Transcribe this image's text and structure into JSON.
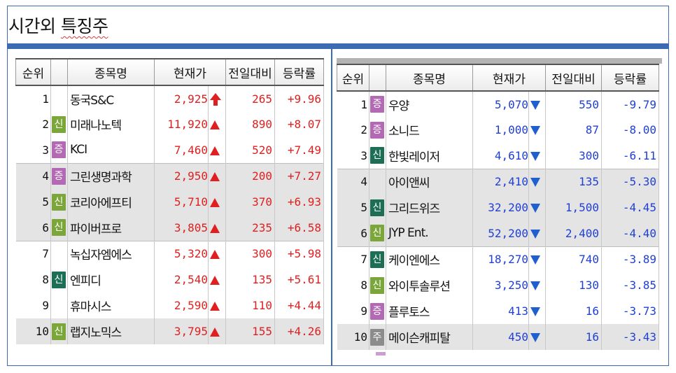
{
  "title": {
    "plain": "시간외 ",
    "underlined": "특징주"
  },
  "headers": [
    "순위",
    "종목명",
    "현재가",
    "전일대비",
    "등락률"
  ],
  "gainers": [
    {
      "rank": "1",
      "badge": "",
      "badge_type": "",
      "name": "동국S&C",
      "price": "2,925",
      "arrow": "bold-up",
      "change": "265",
      "rate": "+9.96"
    },
    {
      "rank": "2",
      "badge": "신",
      "badge_type": "sin",
      "name": "미래나노텍",
      "price": "11,920",
      "arrow": "up",
      "change": "890",
      "rate": "+8.07"
    },
    {
      "rank": "3",
      "badge": "증",
      "badge_type": "jeung",
      "name": "KCI",
      "price": "7,460",
      "arrow": "up",
      "change": "520",
      "rate": "+7.49"
    },
    {
      "rank": "4",
      "badge": "증",
      "badge_type": "jeung",
      "name": "그린생명과학",
      "price": "2,950",
      "arrow": "up",
      "change": "200",
      "rate": "+7.27"
    },
    {
      "rank": "5",
      "badge": "신",
      "badge_type": "sin",
      "name": "코리아에프티",
      "price": "5,710",
      "arrow": "up",
      "change": "370",
      "rate": "+6.93"
    },
    {
      "rank": "6",
      "badge": "신",
      "badge_type": "sin",
      "name": "파이버프로",
      "price": "3,805",
      "arrow": "up",
      "change": "235",
      "rate": "+6.58"
    },
    {
      "rank": "7",
      "badge": "",
      "badge_type": "",
      "name": "녹십자엠에스",
      "price": "5,320",
      "arrow": "up",
      "change": "300",
      "rate": "+5.98"
    },
    {
      "rank": "8",
      "badge": "신",
      "badge_type": "sin-dark",
      "name": "엔피디",
      "price": "2,540",
      "arrow": "up",
      "change": "135",
      "rate": "+5.61"
    },
    {
      "rank": "9",
      "badge": "",
      "badge_type": "",
      "name": "휴마시스",
      "price": "2,590",
      "arrow": "up",
      "change": "110",
      "rate": "+4.44"
    },
    {
      "rank": "10",
      "badge": "신",
      "badge_type": "sin",
      "name": "랩지노믹스",
      "price": "3,795",
      "arrow": "up",
      "change": "155",
      "rate": "+4.26"
    }
  ],
  "losers": [
    {
      "rank": "1",
      "badge": "증",
      "badge_type": "jeung",
      "name": "우양",
      "price": "5,070",
      "arrow": "down",
      "change": "550",
      "rate": "-9.79"
    },
    {
      "rank": "2",
      "badge": "증",
      "badge_type": "jeung",
      "name": "소니드",
      "price": "1,000",
      "arrow": "down",
      "change": "87",
      "rate": "-8.00"
    },
    {
      "rank": "3",
      "badge": "신",
      "badge_type": "sin-dark",
      "name": "한빛레이저",
      "price": "4,610",
      "arrow": "down",
      "change": "300",
      "rate": "-6.11"
    },
    {
      "rank": "4",
      "badge": "",
      "badge_type": "",
      "name": "아이앤씨",
      "price": "2,410",
      "arrow": "down",
      "change": "135",
      "rate": "-5.30"
    },
    {
      "rank": "5",
      "badge": "신",
      "badge_type": "sin-dark",
      "name": "그리드위즈",
      "price": "32,200",
      "arrow": "down",
      "change": "1,500",
      "rate": "-4.45"
    },
    {
      "rank": "6",
      "badge": "신",
      "badge_type": "sin",
      "name": "JYP Ent.",
      "price": "52,200",
      "arrow": "down",
      "change": "2,400",
      "rate": "-4.40"
    },
    {
      "rank": "7",
      "badge": "신",
      "badge_type": "sin-dark",
      "name": "케이엔에스",
      "price": "18,270",
      "arrow": "down",
      "change": "740",
      "rate": "-3.89"
    },
    {
      "rank": "8",
      "badge": "신",
      "badge_type": "sin",
      "name": "와이투솔루션",
      "price": "3,250",
      "arrow": "down",
      "change": "130",
      "rate": "-3.85"
    },
    {
      "rank": "9",
      "badge": "증",
      "badge_type": "jeung",
      "name": "플루토스",
      "price": "413",
      "arrow": "down",
      "change": "16",
      "rate": "-3.73"
    },
    {
      "rank": "10",
      "badge": "주",
      "badge_type": "ju",
      "name": "메이슨캐피탈",
      "price": "450",
      "arrow": "down",
      "change": "16",
      "rate": "-3.43"
    }
  ]
}
